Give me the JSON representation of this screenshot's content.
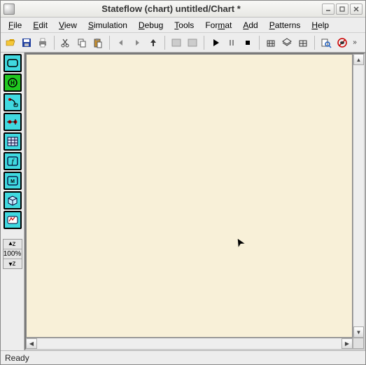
{
  "titlebar": {
    "title": "Stateflow (chart) untitled/Chart *"
  },
  "menu": {
    "items": [
      {
        "label": "File",
        "u": 0
      },
      {
        "label": "Edit",
        "u": 0
      },
      {
        "label": "View",
        "u": 0
      },
      {
        "label": "Simulation",
        "u": 0
      },
      {
        "label": "Debug",
        "u": 0
      },
      {
        "label": "Tools",
        "u": 0
      },
      {
        "label": "Format",
        "u": 3
      },
      {
        "label": "Add",
        "u": 0
      },
      {
        "label": "Patterns",
        "u": 0
      },
      {
        "label": "Help",
        "u": 0
      }
    ]
  },
  "toolbar": {
    "groups": [
      [
        "open",
        "save",
        "print"
      ],
      [
        "cut",
        "copy",
        "paste"
      ],
      [
        "back",
        "forward",
        "up"
      ],
      [
        "shade1",
        "shade2"
      ],
      [
        "play",
        "pause",
        "stop"
      ],
      [
        "build1",
        "build2",
        "build3"
      ],
      [
        "find",
        "nobugs"
      ]
    ]
  },
  "sidebar": {
    "tools": [
      "state-tool",
      "history-tool",
      "default-transition-tool",
      "junction-tool",
      "truth-table-tool",
      "function-tool",
      "embedded-matlab-tool",
      "box-tool",
      "simulink-function-tool"
    ]
  },
  "zoom": {
    "in_label": "z",
    "value": "100%",
    "out_label": "z"
  },
  "status": {
    "text": "Ready"
  }
}
